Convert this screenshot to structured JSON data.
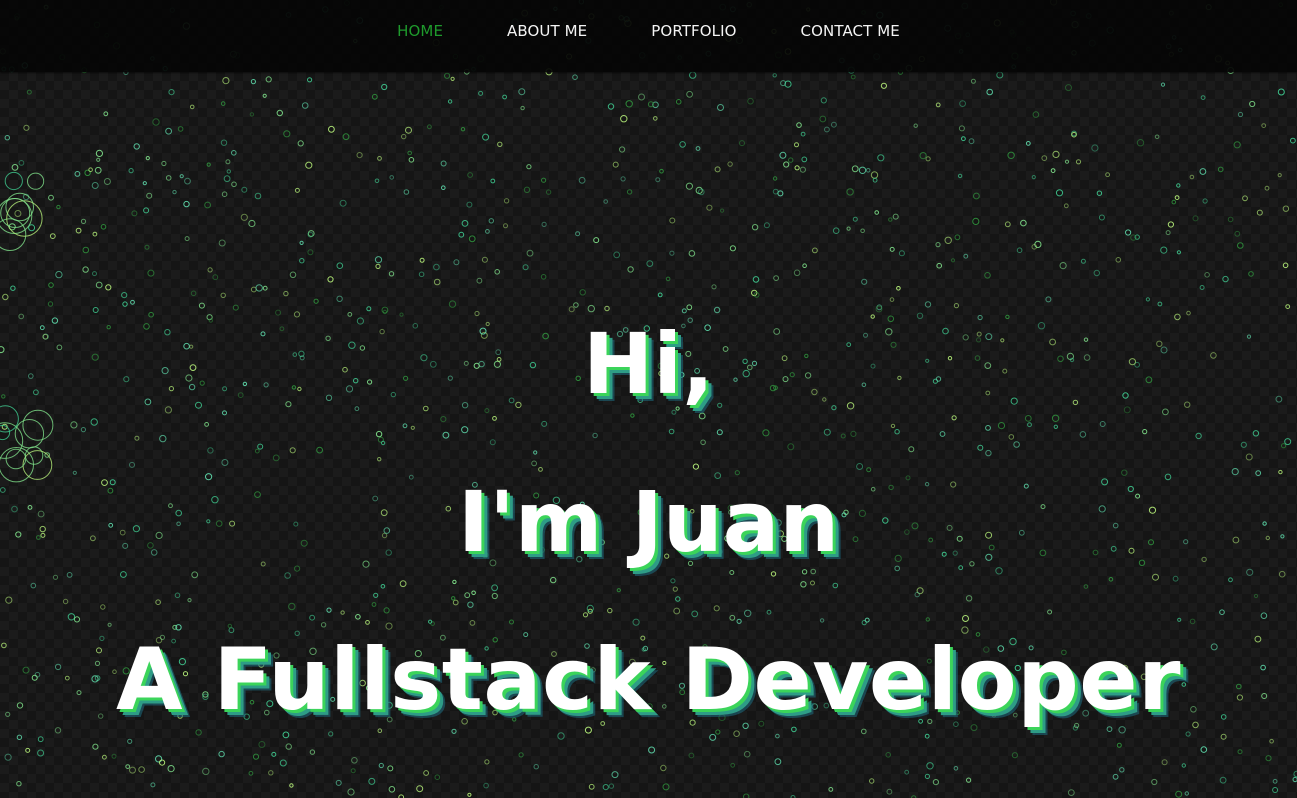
{
  "nav": {
    "items": [
      {
        "label": "HOME",
        "active": true
      },
      {
        "label": "ABOUT ME",
        "active": false
      },
      {
        "label": "PORTFOLIO",
        "active": false
      },
      {
        "label": "CONTACT ME",
        "active": false
      }
    ]
  },
  "hero": {
    "line1": "Hi,",
    "line2": "I'm Juan",
    "line3": "A Fullstack Developer"
  },
  "colors": {
    "nav_active": "#1e9a2c",
    "nav_text": "#f4f4f4",
    "heading_text": "#ffffff",
    "shadow_green": "#3bd45a",
    "shadow_teal": "#2e9c86",
    "background": "#151515",
    "particle_colors": [
      "#7fe08a",
      "#3fc98f",
      "#b6f07a",
      "#2f8f3c",
      "#5dd6a8"
    ]
  }
}
